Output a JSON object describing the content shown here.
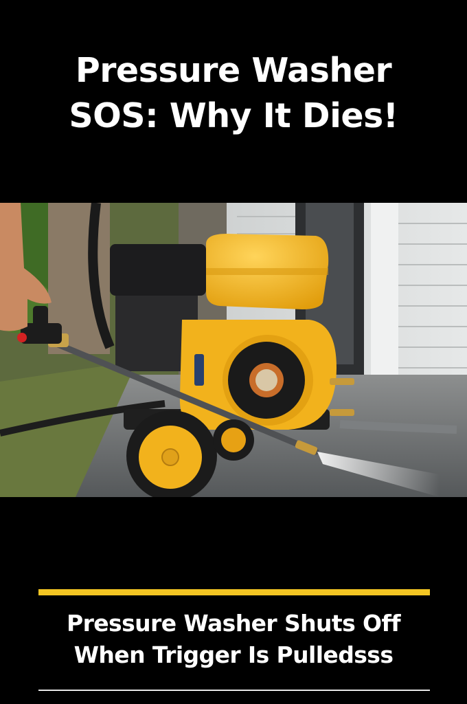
{
  "headline": {
    "line1": "Pressure Washer",
    "line2": "SOS: Why It Dies!"
  },
  "photo": {
    "subject": "pressure-washer-photo"
  },
  "subheadline": {
    "line1": "Pressure Washer Shuts Off",
    "line2": "When Trigger Is Pulledsss"
  },
  "colors": {
    "background": "#000000",
    "accent": "#f3c623",
    "text": "#ffffff",
    "machine_yellow": "#f2b21c"
  }
}
